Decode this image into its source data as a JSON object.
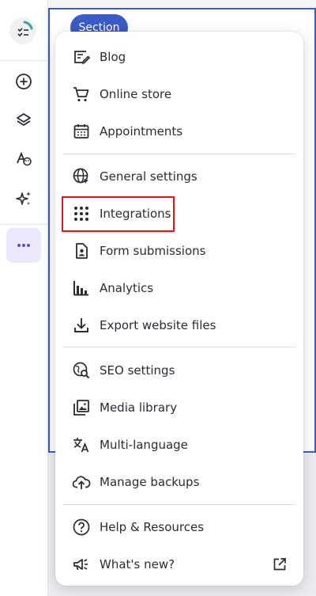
{
  "canvas": {
    "section_label": "Section"
  },
  "rail": {
    "items": [
      {
        "name": "add-icon"
      },
      {
        "name": "layers-icon"
      },
      {
        "name": "styles-icon"
      },
      {
        "name": "ai-sparkle-icon"
      },
      {
        "name": "more-icon"
      }
    ]
  },
  "menu": {
    "groups": [
      [
        {
          "label": "Blog",
          "icon": "blog-icon"
        },
        {
          "label": "Online store",
          "icon": "cart-icon"
        },
        {
          "label": "Appointments",
          "icon": "calendar-icon"
        }
      ],
      [
        {
          "label": "General settings",
          "icon": "globe-settings-icon"
        },
        {
          "label": "Integrations",
          "icon": "grid-dots-icon"
        },
        {
          "label": "Form submissions",
          "icon": "form-icon"
        },
        {
          "label": "Analytics",
          "icon": "bar-chart-icon"
        },
        {
          "label": "Export website files",
          "icon": "download-icon"
        }
      ],
      [
        {
          "label": "SEO settings",
          "icon": "seo-icon"
        },
        {
          "label": "Media library",
          "icon": "media-icon"
        },
        {
          "label": "Multi-language",
          "icon": "translate-icon"
        },
        {
          "label": "Manage backups",
          "icon": "cloud-backup-icon"
        }
      ],
      [
        {
          "label": "Help & Resources",
          "icon": "help-icon"
        },
        {
          "label": "What's new?",
          "icon": "megaphone-icon",
          "external": true
        }
      ]
    ]
  },
  "colors": {
    "accent": "#3b5bc6",
    "highlight": "#e0161e",
    "active_bg": "#ebe8ff",
    "icon": "#2b2c33"
  }
}
